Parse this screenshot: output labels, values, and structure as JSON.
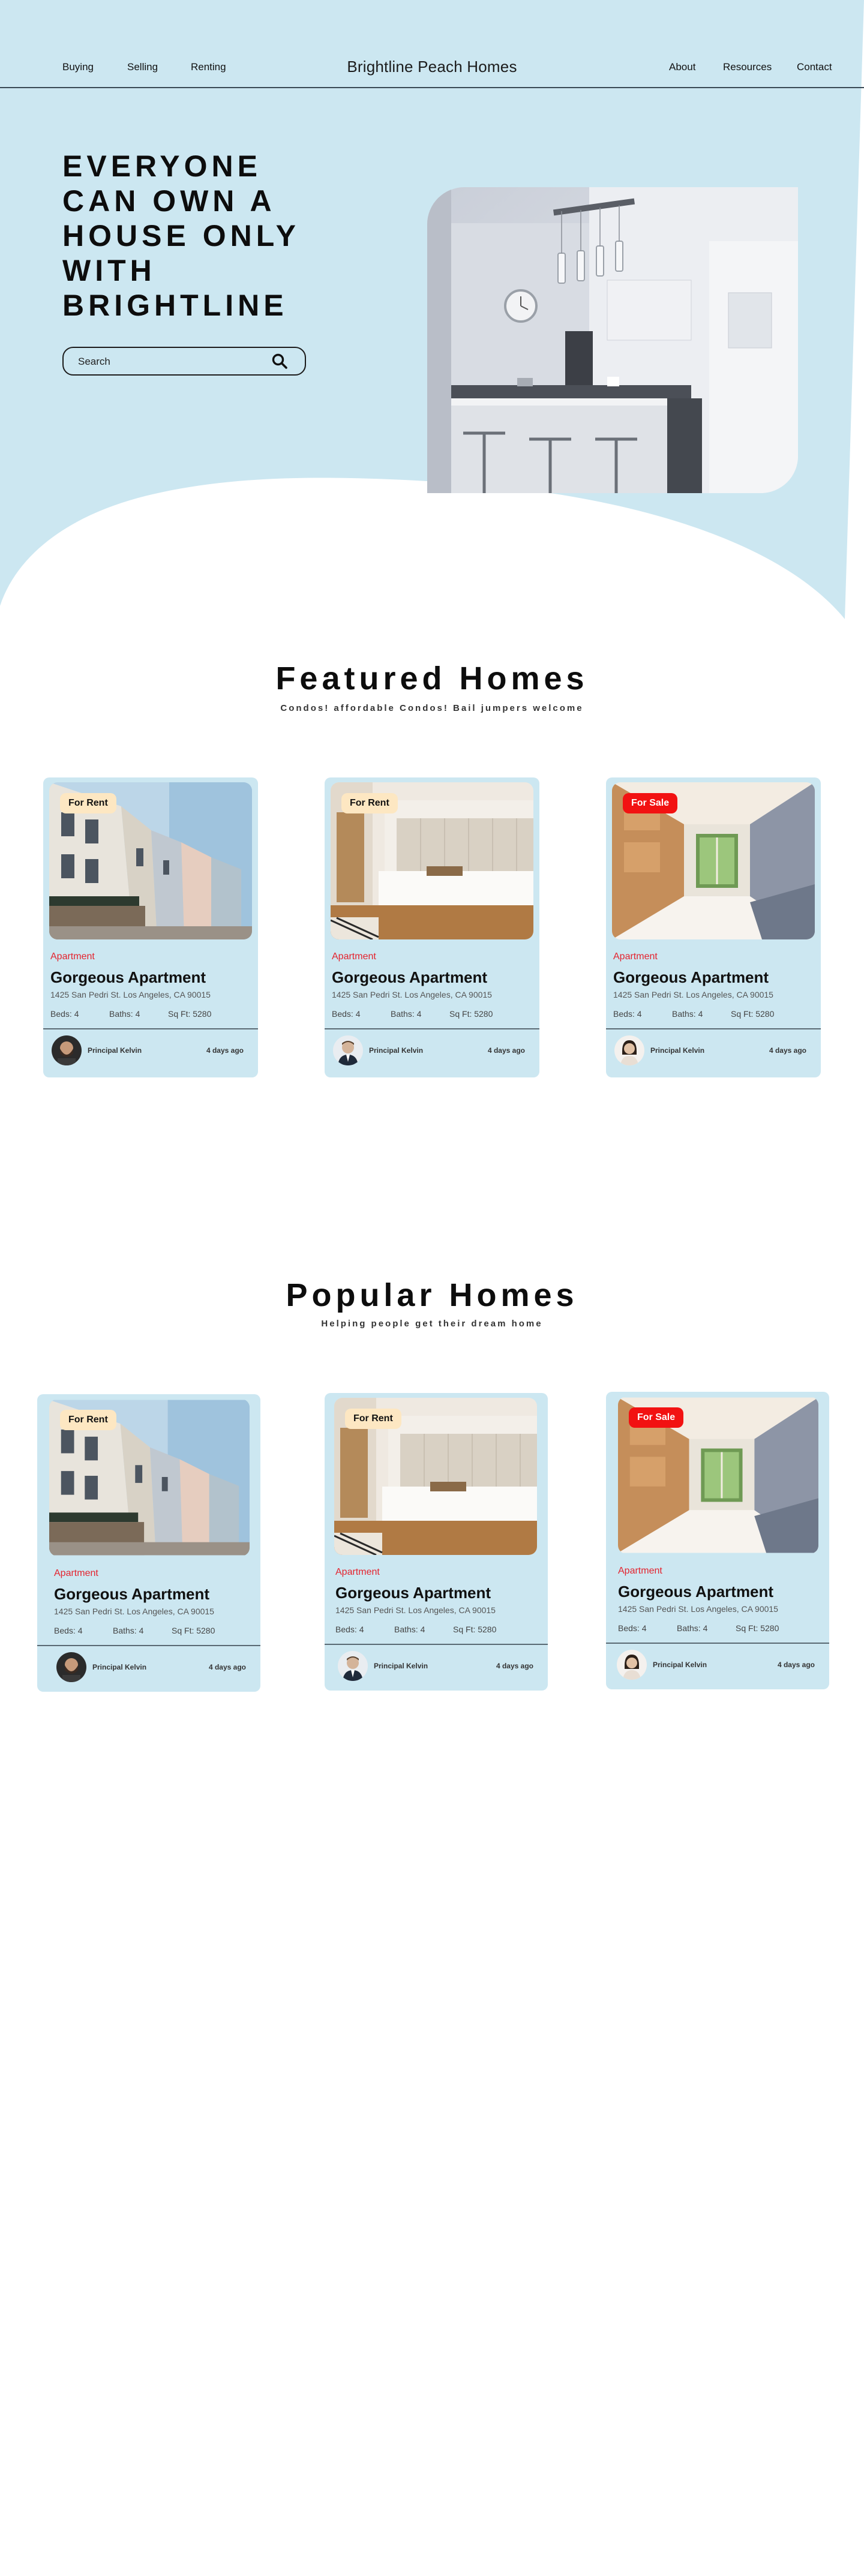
{
  "nav": {
    "left": [
      "Buying",
      "Selling",
      "Renting"
    ],
    "brand": "Brightline Peach Homes",
    "right": [
      "About",
      "Resources",
      "Contact"
    ]
  },
  "hero": {
    "title": "EVERYONE CAN OWN A HOUSE ONLY WITH BRIGHTLINE",
    "search_placeholder": "Search",
    "search_icon": "search-icon",
    "image": "kitchen-photo"
  },
  "featured": {
    "title": "Featured Homes",
    "subtitle": "Condos! affordable Condos! Bail jumpers welcome",
    "cards": [
      {
        "badge": "For Rent",
        "type": "Apartment",
        "name": "Gorgeous Apartment",
        "address": "1425 San Pedri St. Los Angeles, CA 90015",
        "beds": "Beds: 4",
        "baths": "Baths: 4",
        "sqft": "Sq Ft: 5280",
        "agent": "Principal Kelvin",
        "time": "4 days ago",
        "image": "street-photo",
        "avatar": "bearded-man-avatar"
      },
      {
        "badge": "For Rent",
        "type": "Apartment",
        "name": "Gorgeous Apartment",
        "address": "1425 San Pedri St. Los Angeles, CA 90015",
        "beds": "Beds: 4",
        "baths": "Baths: 4",
        "sqft": "Sq Ft: 5280",
        "agent": "Principal Kelvin",
        "time": "4 days ago",
        "image": "bedroom-photo",
        "avatar": "suited-man-avatar"
      },
      {
        "badge": "For Sale",
        "type": "Apartment",
        "name": "Gorgeous Apartment",
        "address": "1425 San Pedri St. Los Angeles, CA 90015",
        "beds": "Beds: 4",
        "baths": "Baths: 4",
        "sqft": "Sq Ft: 5280",
        "agent": "Principal Kelvin",
        "time": "4 days ago",
        "image": "kitchen-interior-photo",
        "avatar": "woman-avatar"
      }
    ]
  },
  "popular": {
    "title": "Popular Homes",
    "subtitle": "Helping people get their dream home",
    "cards": [
      {
        "badge": "For Rent",
        "type": "Apartment",
        "name": "Gorgeous Apartment",
        "address": "1425 San Pedri St. Los Angeles, CA 90015",
        "beds": "Beds: 4",
        "baths": "Baths: 4",
        "sqft": "Sq Ft: 5280",
        "agent": "Principal Kelvin",
        "time": "4 days ago",
        "image": "street-photo",
        "avatar": "bearded-man-avatar"
      },
      {
        "badge": "For Rent",
        "type": "Apartment",
        "name": "Gorgeous Apartment",
        "address": "1425 San Pedri St. Los Angeles, CA 90015",
        "beds": "Beds: 4",
        "baths": "Baths: 4",
        "sqft": "Sq Ft: 5280",
        "agent": "Principal Kelvin",
        "time": "4 days ago",
        "image": "bedroom-photo",
        "avatar": "suited-man-avatar"
      },
      {
        "badge": "For Sale",
        "type": "Apartment",
        "name": "Gorgeous Apartment",
        "address": "1425 San Pedri St. Los Angeles, CA 90015",
        "beds": "Beds: 4",
        "baths": "Baths: 4",
        "sqft": "Sq Ft: 5280",
        "agent": "Principal Kelvin",
        "time": "4 days ago",
        "image": "kitchen-interior-photo",
        "avatar": "woman-avatar"
      }
    ]
  },
  "colors": {
    "hero_bg": "#cce7f1",
    "card_bg": "#cce7f1",
    "accent_red": "#e4232e",
    "sale_badge": "#f21212",
    "rent_badge": "#fde7c2"
  }
}
